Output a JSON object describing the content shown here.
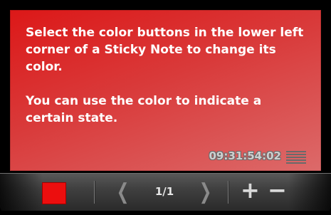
{
  "note": {
    "color": "#dc2a2a",
    "paragraphs": [
      "Select the color buttons in the lower left corner of a Sticky Note to change its color.",
      "You can use the color to indicate a certain state."
    ],
    "timestamp": "09:31:54:02",
    "menu_icon": "hamburger-icon"
  },
  "toolbar": {
    "color_button_color": "#ec0e0e",
    "prev_label": "❮",
    "page_indicator": "1/1",
    "next_label": "❯",
    "add_label": "+",
    "remove_label": "−"
  }
}
